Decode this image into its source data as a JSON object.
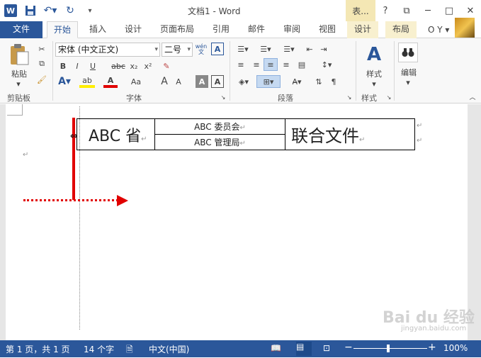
{
  "titlebar": {
    "title": "文档1 - Word",
    "context_tab": "表...",
    "help": "?",
    "restore": "⧉",
    "minimize": "─",
    "maximize": "□",
    "close": "✕"
  },
  "tabs": [
    {
      "label": "文件"
    },
    {
      "label": "开始"
    },
    {
      "label": "插入"
    },
    {
      "label": "设计"
    },
    {
      "label": "页面布局"
    },
    {
      "label": "引用"
    },
    {
      "label": "邮件"
    },
    {
      "label": "审阅"
    },
    {
      "label": "视图"
    },
    {
      "label": "设计"
    },
    {
      "label": "布局"
    }
  ],
  "user": "O Y ▾",
  "ribbon": {
    "clipboard": {
      "paste": "粘贴",
      "label": "剪贴板"
    },
    "font": {
      "font_name": "宋体 (中文正文)",
      "font_size": "二号",
      "label": "字体",
      "bold": "B",
      "italic": "I",
      "underline": "U",
      "strike": "abc",
      "sub": "x₂",
      "sup": "x²",
      "aa": "Aa",
      "grow": "A",
      "shrink": "A",
      "wen": "wén文",
      "boxa": "A",
      "clear": "A",
      "charshade": "A"
    },
    "paragraph": {
      "label": "段落"
    },
    "styles": {
      "label": "样式",
      "button": "样式"
    },
    "editing": {
      "button": "编辑"
    }
  },
  "document": {
    "cell_province": "ABC 省",
    "cell_committee": "ABC 委员会",
    "cell_bureau": "ABC 管理局",
    "cell_joint": "联合文件",
    "para_mark": "↵",
    "cell_mark": "↵"
  },
  "status": {
    "page": "第 1 页，共 1 页",
    "words": "14 个字",
    "lang": "中文(中国)",
    "zoom": "100%",
    "zoom_minus": "−",
    "zoom_plus": "+"
  },
  "watermark": {
    "text": "Bai du 经验",
    "sub": "jingyan.baidu.com"
  }
}
